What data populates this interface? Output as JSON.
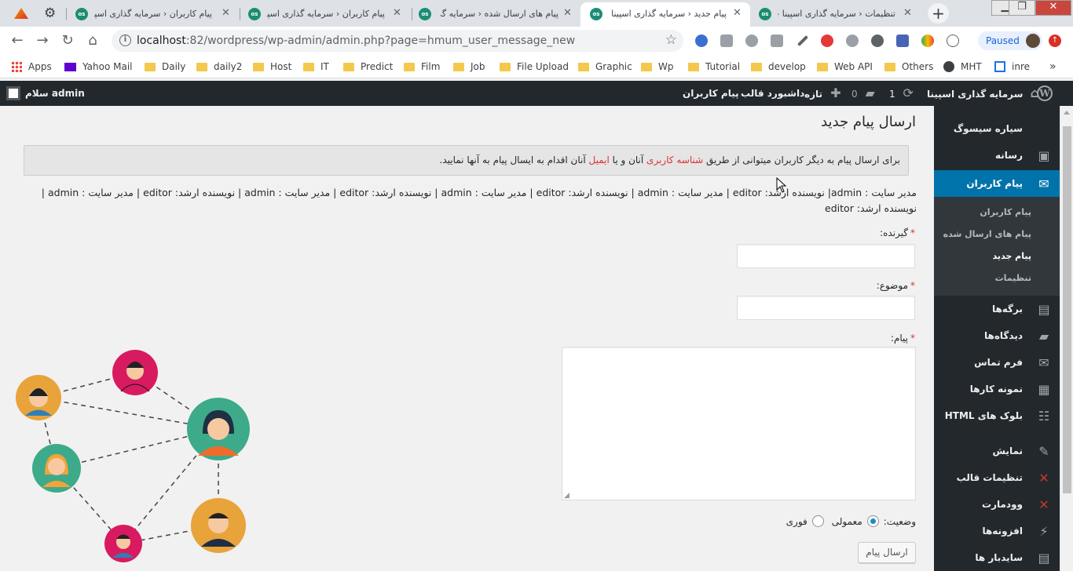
{
  "browser": {
    "tabs": [
      {
        "title": "تنظیمات ‹ سرمایه گذاری اسپینا — ور",
        "active": false
      },
      {
        "title": "پیام جدید ‹ سرمایه گذاری اسپینا — ور",
        "active": true
      },
      {
        "title": "پیام های ارسال شده ‹ سرمایه گذاری",
        "active": false
      },
      {
        "title": "پیام کاربران ‹ سرمایه گذاری اسپینا —",
        "active": false
      },
      {
        "title": "پیام کاربران ‹ سرمایه گذاری اسپینا",
        "active": false
      }
    ],
    "favicon_text": "os",
    "url_host": "localhost",
    "url_path": ":82/wordpress/wp-admin/admin.php?page=hmum_user_message_new",
    "paused_label": "Paused",
    "bookmarks": [
      "Apps",
      "Yahoo Mail",
      "Daily",
      "daily2",
      "Host",
      "IT",
      "Predict",
      "Film",
      "Job",
      "File Upload",
      "Graphic",
      "Wp",
      "Tutorial",
      "develop",
      "Web API",
      "Others",
      "MHT",
      "inre"
    ]
  },
  "adminbar": {
    "greeting": "سلام admin",
    "site_name": "سرمایه گذاری اسپینا",
    "updates_count": "1",
    "comments_count": "0",
    "new_label": "تازه",
    "theme_dashboard": "داشبورد قالب",
    "user_messages": "پیام کاربران"
  },
  "sidebar": {
    "items_top": [
      {
        "label": "سیاره سیسوگ",
        "icon": "planet-icon"
      },
      {
        "label": "رسانه",
        "icon": "media-icon"
      }
    ],
    "current": {
      "label": "پیام کاربران",
      "icon": "envelope-icon"
    },
    "submenu": [
      "پیام کاربران",
      "پیام های ارسال شده",
      "پیام جدید",
      "تنظیمات"
    ],
    "submenu_current_index": 2,
    "items_bottom": [
      {
        "label": "برگه‌ها",
        "icon": "pages-icon"
      },
      {
        "label": "دیدگاه‌ها",
        "icon": "comments-icon"
      },
      {
        "label": "فرم تماس",
        "icon": "mail-icon"
      },
      {
        "label": "نمونه کارها",
        "icon": "portfolio-icon"
      },
      {
        "label": "بلوک های HTML",
        "icon": "grid-icon"
      },
      {
        "label": "نمایش",
        "icon": "brush-icon"
      },
      {
        "label": "تنظیمات قالب",
        "icon": "theme-settings-icon"
      },
      {
        "label": "وودمارت",
        "icon": "woodmart-icon"
      },
      {
        "label": "افزونه‌ها",
        "icon": "plugins-icon"
      },
      {
        "label": "ساید‌بار ها",
        "icon": "sidebars-icon"
      }
    ]
  },
  "page": {
    "title": "ارسال پیام جدید",
    "notice_before": "برای ارسال پیام به دیگر کاربران میتوانی از طریق ",
    "notice_link1": "شناسه کاربری",
    "notice_middle": " آنان و یا ",
    "notice_link2": "ایمیل",
    "notice_after": " آنان اقدام به ایسال پیام به آنها نمایید.",
    "roles_line": "مدیر سایت : admin| نویسنده ارشد: editor | مدیر سایت : admin | نویسنده ارشد: editor | مدیر سایت : admin | نویسنده ارشد: editor | مدیر سایت : admin | نویسنده ارشد: editor | مدیر سایت : admin | نویسنده ارشد: editor",
    "recipient_label": "گیرنده:",
    "subject_label": "موضوع:",
    "message_label": "پیام:",
    "required_mark": "*",
    "status_label": "وضعیت:",
    "status_normal": "معمولی",
    "status_urgent": "فوری",
    "send_button": "ارسال پیام"
  },
  "colors": {
    "wp_dark": "#23282d",
    "wp_blue": "#0073aa",
    "red": "#dc3232"
  }
}
